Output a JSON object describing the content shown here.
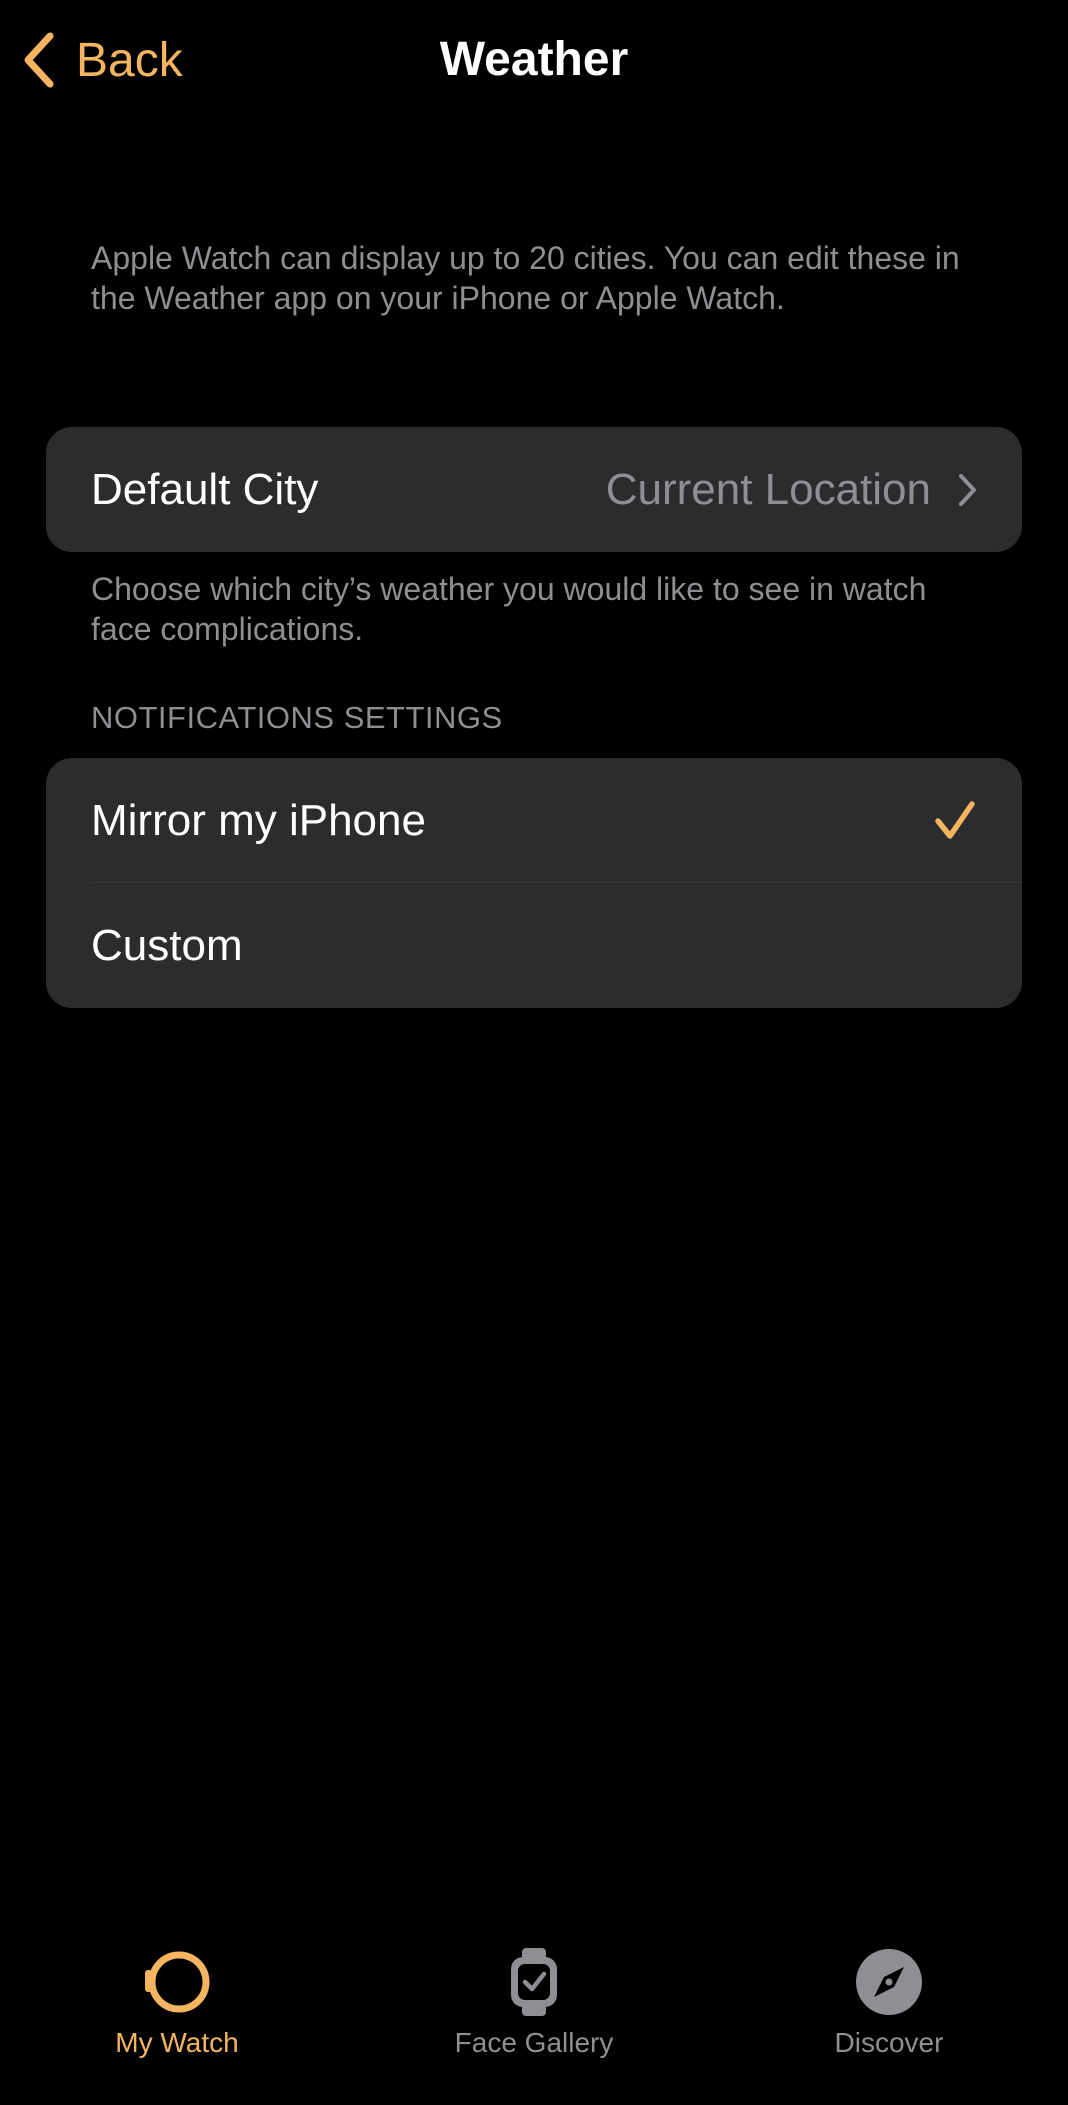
{
  "colors": {
    "accent": "#f4b460",
    "background": "#000000",
    "cell_background": "#2c2c2e",
    "secondary_text": "#8e8e93"
  },
  "nav": {
    "back_label": "Back",
    "title": "Weather"
  },
  "intro_text": "Apple Watch can display up to 20 cities. You can edit these in the Weather app on your iPhone or Apple Watch.",
  "default_city": {
    "label": "Default City",
    "value": "Current Location",
    "footer": "Choose which city’s weather you would like to see in watch face complications."
  },
  "notifications": {
    "header": "NOTIFICATIONS SETTINGS",
    "options": [
      {
        "label": "Mirror my iPhone",
        "selected": true
      },
      {
        "label": "Custom",
        "selected": false
      }
    ]
  },
  "tab_bar": {
    "tabs": [
      {
        "label": "My Watch",
        "icon": "watch-icon",
        "active": true
      },
      {
        "label": "Face Gallery",
        "icon": "watch-face-icon",
        "active": false
      },
      {
        "label": "Discover",
        "icon": "compass-icon",
        "active": false
      }
    ]
  }
}
